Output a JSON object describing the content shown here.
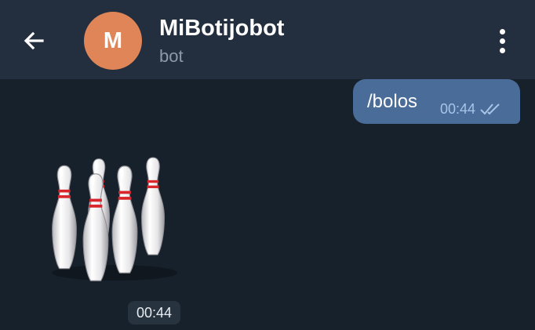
{
  "header": {
    "chat_title": "MiBotijobot",
    "chat_subtitle": "bot",
    "avatar_letter": "M",
    "avatar_color": "#df8558"
  },
  "messages": {
    "outgoing": {
      "text": "/bolos",
      "time": "00:44",
      "status_icon": "double-check-icon"
    },
    "incoming_sticker": {
      "sticker_name": "bowling-pins",
      "time": "00:44"
    }
  },
  "colors": {
    "header_bg": "#232f3e",
    "chat_bg": "#17212b",
    "outgoing_bubble": "#4a6c98",
    "read_check": "#a8c5e8"
  }
}
